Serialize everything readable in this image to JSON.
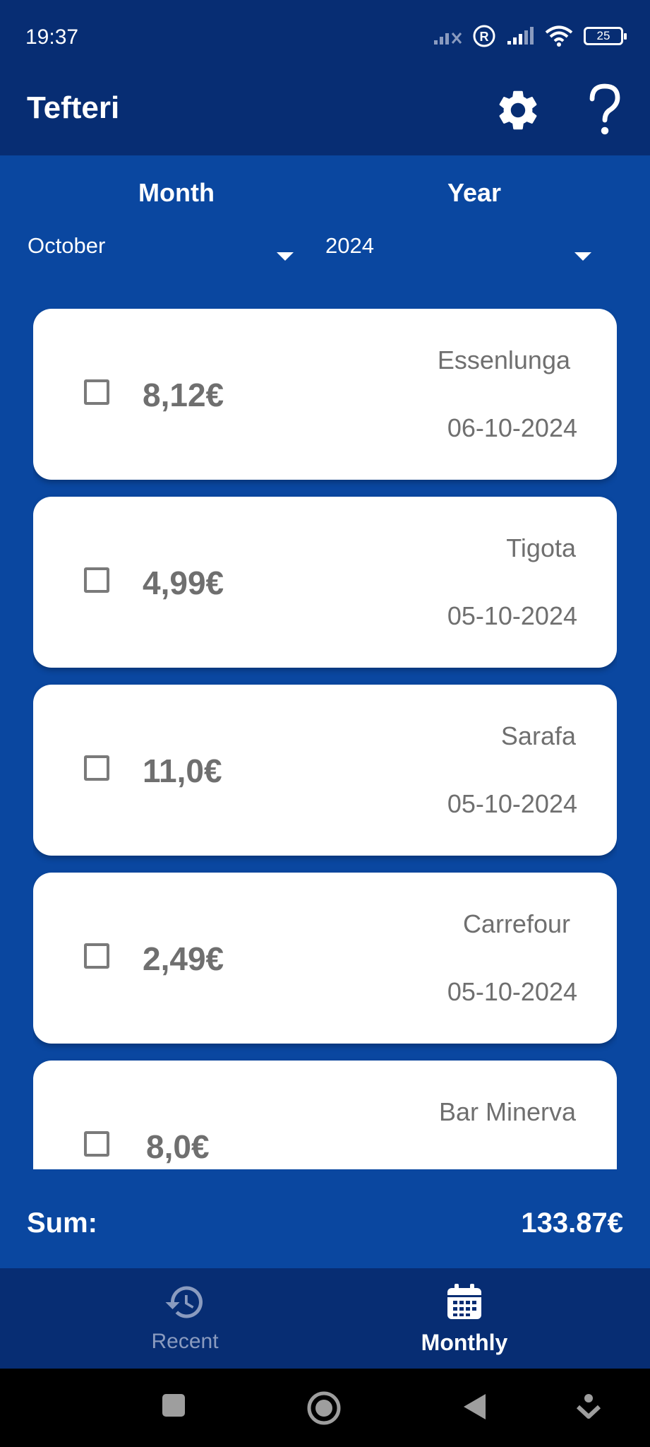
{
  "status": {
    "time": "19:37",
    "battery": "25"
  },
  "app": {
    "title": "Tefteri",
    "settings_icon": "gear-icon",
    "help_icon": "help-icon"
  },
  "filters": {
    "month_label": "Month",
    "year_label": "Year",
    "month_value": "October",
    "year_value": "2024"
  },
  "expenses": [
    {
      "amount": "8,12€",
      "store": "Essenlunga",
      "date": "06-10-2024",
      "checked": false
    },
    {
      "amount": "4,99€",
      "store": "Tigota",
      "date": "05-10-2024",
      "checked": false
    },
    {
      "amount": "11,0€",
      "store": "Sarafa",
      "date": "05-10-2024",
      "checked": false
    },
    {
      "amount": "2,49€",
      "store": "Carrefour",
      "date": "05-10-2024",
      "checked": false
    },
    {
      "amount": "8,0€",
      "store": "Bar Minerva",
      "date": "",
      "checked": false
    }
  ],
  "summary": {
    "label": "Sum:",
    "value": "133.87€"
  },
  "nav": {
    "recent": {
      "label": "Recent",
      "icon": "history-icon"
    },
    "monthly": {
      "label": "Monthly",
      "icon": "calendar-icon"
    }
  },
  "colors": {
    "primary_dark": "#072d73",
    "primary": "#0a47a0",
    "card": "#ffffff",
    "text_gray": "#6f6f6f"
  }
}
